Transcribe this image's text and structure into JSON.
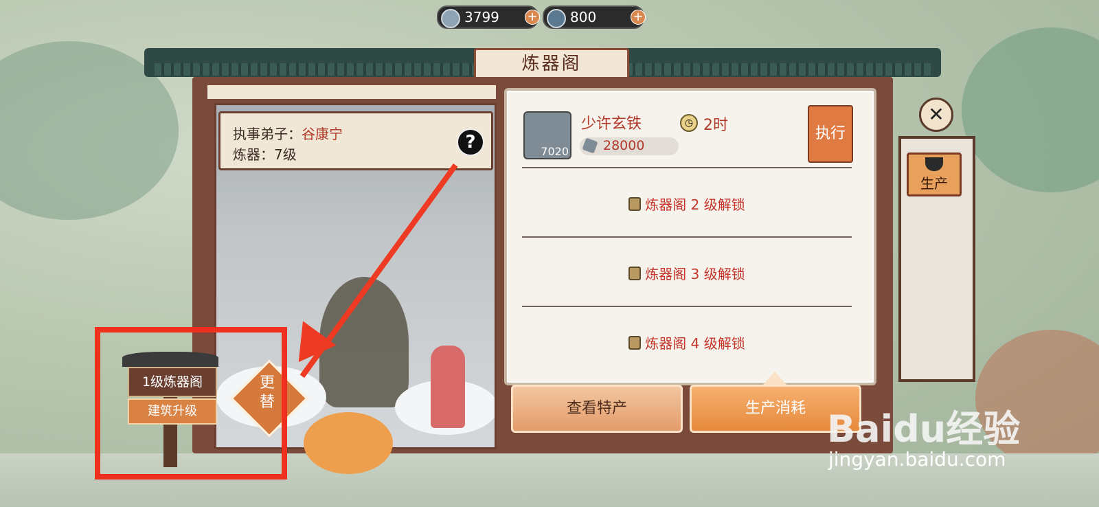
{
  "resources": [
    {
      "name": "silver-ore",
      "value": "3799"
    },
    {
      "name": "iron-ingot",
      "value": "800"
    }
  ],
  "building": {
    "title": "炼器阁"
  },
  "info": {
    "disciple_label": "执事弟子：",
    "disciple_name": "谷康宁",
    "refine_label": "炼器：",
    "refine_level": "7级",
    "help_glyph": "?"
  },
  "recipe": {
    "item_name": "少许玄铁",
    "item_count": "7020",
    "time": "2时",
    "cost": "28000",
    "execute_label": "执行"
  },
  "locked_slots": [
    {
      "label": "炼器阁 2 级解锁"
    },
    {
      "label": "炼器阁 3 级解锁"
    },
    {
      "label": "炼器阁 4 级解锁"
    }
  ],
  "buttons": {
    "view_products": "查看特产",
    "production_cost": "生产消耗",
    "produce": "生产",
    "replace": "更替",
    "close": "✕"
  },
  "sign": {
    "level_text": "1级炼器阁",
    "upgrade_text": "建筑升级"
  },
  "watermark": {
    "brand": "Baidu经验",
    "url": "jingyan.baidu.com"
  },
  "colors": {
    "accent_orange": "#e68a3c",
    "highlight_red": "#f0301e",
    "text_red": "#b23a2a"
  }
}
